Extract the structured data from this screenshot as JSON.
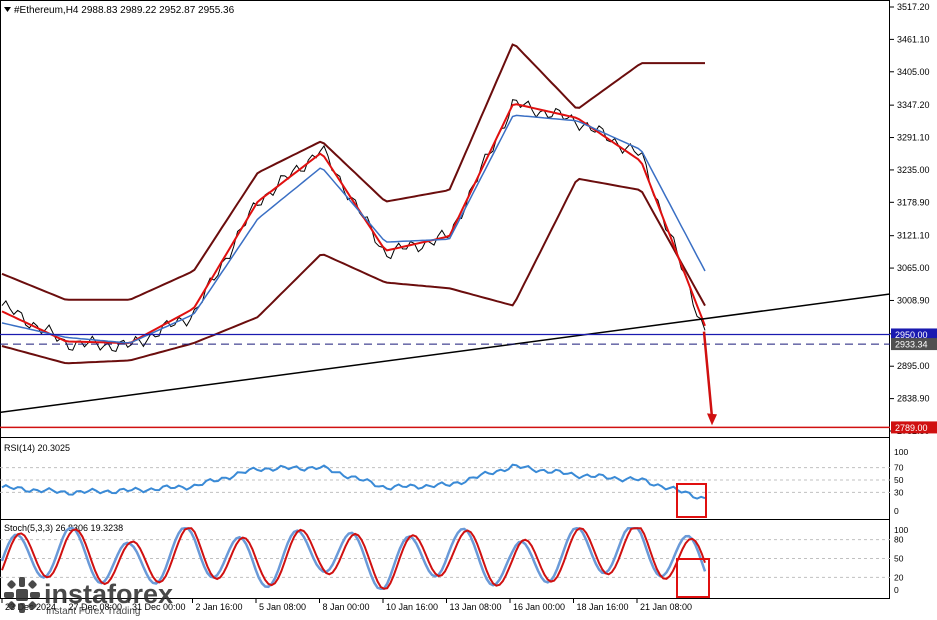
{
  "header": {
    "symbol_line": "#Ethereum,H4  2988.83 2989.22 2952.87 2955.36"
  },
  "main_axis": {
    "ticks": [
      "3517.20",
      "3461.10",
      "3405.00",
      "3347.20",
      "3291.10",
      "3235.00",
      "3178.90",
      "3121.10",
      "3065.00",
      "3008.90",
      "2951.10",
      "2895.00",
      "2838.90",
      "2782.80"
    ],
    "min": 2782.8,
    "max": 3517.2
  },
  "price_labels": {
    "blue_level": "2950.00",
    "current_price": "2933.34",
    "red_level": "2789.00"
  },
  "rsi": {
    "title": "RSI(14) 20.3025",
    "ticks": [
      "100",
      "70",
      "50",
      "30",
      "0"
    ]
  },
  "stoch": {
    "title": "Stoch(5,3,3) 26.8306 19.3238",
    "ticks": [
      "100",
      "80",
      "50",
      "20",
      "0"
    ]
  },
  "x_axis": {
    "labels": [
      "23 Dec 2024",
      "27 Dec 08:00",
      "31 Dec 00:00",
      "2 Jan 16:00",
      "5 Jan 08:00",
      "8 Jan 00:00",
      "10 Jan 16:00",
      "13 Jan 08:00",
      "16 Jan 00:00",
      "18 Jan 16:00",
      "21 Jan 08:00"
    ]
  },
  "watermark": {
    "brand": "instaforex",
    "tagline": "Instant Forex Trading"
  },
  "colors": {
    "price": "#000000",
    "bollinger": "#6b0d0d",
    "fast_ma": "#e01010",
    "slow_ma": "#3a6fc4",
    "blue_level": "#1a1ab0",
    "red_level": "#d01010",
    "trendline": "#000000",
    "rsi_line": "#3a8ad6",
    "stoch_main": "#6a9ad8",
    "stoch_signal": "#d01010",
    "highlight_box": "#e01010"
  },
  "chart_data": [
    {
      "type": "line",
      "title": "#Ethereum,H4",
      "ohlc_last": {
        "open": 2988.83,
        "high": 2989.22,
        "low": 2952.87,
        "close": 2955.36
      },
      "x": [
        "23 Dec 2024",
        "27 Dec 08:00",
        "31 Dec 00:00",
        "2 Jan 16:00",
        "5 Jan 08:00",
        "8 Jan 00:00",
        "10 Jan 16:00",
        "13 Jan 08:00",
        "16 Jan 00:00",
        "18 Jan 16:00",
        "21 Jan 08:00"
      ],
      "series": [
        {
          "name": "close",
          "values": [
            3000,
            2935,
            2930,
            2985,
            3180,
            3270,
            3090,
            3120,
            3350,
            3320,
            3260,
            2955
          ]
        },
        {
          "name": "upper band",
          "values": [
            3055,
            3010,
            3010,
            3060,
            3230,
            3285,
            3180,
            3200,
            3455,
            3340,
            3420,
            3420
          ]
        },
        {
          "name": "lower band",
          "values": [
            2930,
            2900,
            2905,
            2935,
            2980,
            3090,
            3040,
            3030,
            3000,
            3220,
            3200,
            3000
          ]
        },
        {
          "name": "fast MA",
          "values": [
            2990,
            2938,
            2935,
            2995,
            3180,
            3265,
            3095,
            3120,
            3350,
            3325,
            3250,
            2965
          ]
        },
        {
          "name": "slow MA",
          "values": [
            2970,
            2945,
            2935,
            2985,
            3150,
            3240,
            3110,
            3115,
            3330,
            3320,
            3270,
            3060
          ]
        }
      ],
      "levels": [
        2950.0,
        2933.34,
        2789.0
      ],
      "ylim": [
        2782.8,
        3517.2
      ]
    },
    {
      "type": "line",
      "title": "RSI(14) 20.3025",
      "series": [
        {
          "name": "RSI",
          "values": [
            38,
            30,
            33,
            40,
            68,
            70,
            38,
            42,
            72,
            58,
            50,
            20
          ]
        }
      ],
      "ylim": [
        0,
        100
      ],
      "levels": [
        70,
        50,
        30
      ]
    },
    {
      "type": "line",
      "title": "Stoch(5,3,3) 26.8306 19.3238",
      "series": [
        {
          "name": "main",
          "values": [
            40,
            85,
            15,
            90,
            20,
            95,
            15,
            90,
            15,
            80,
            95,
            27
          ]
        },
        {
          "name": "signal",
          "values": [
            45,
            80,
            20,
            85,
            25,
            90,
            20,
            85,
            20,
            75,
            90,
            19
          ]
        }
      ],
      "ylim": [
        0,
        100
      ],
      "levels": [
        80,
        50,
        20
      ]
    }
  ]
}
